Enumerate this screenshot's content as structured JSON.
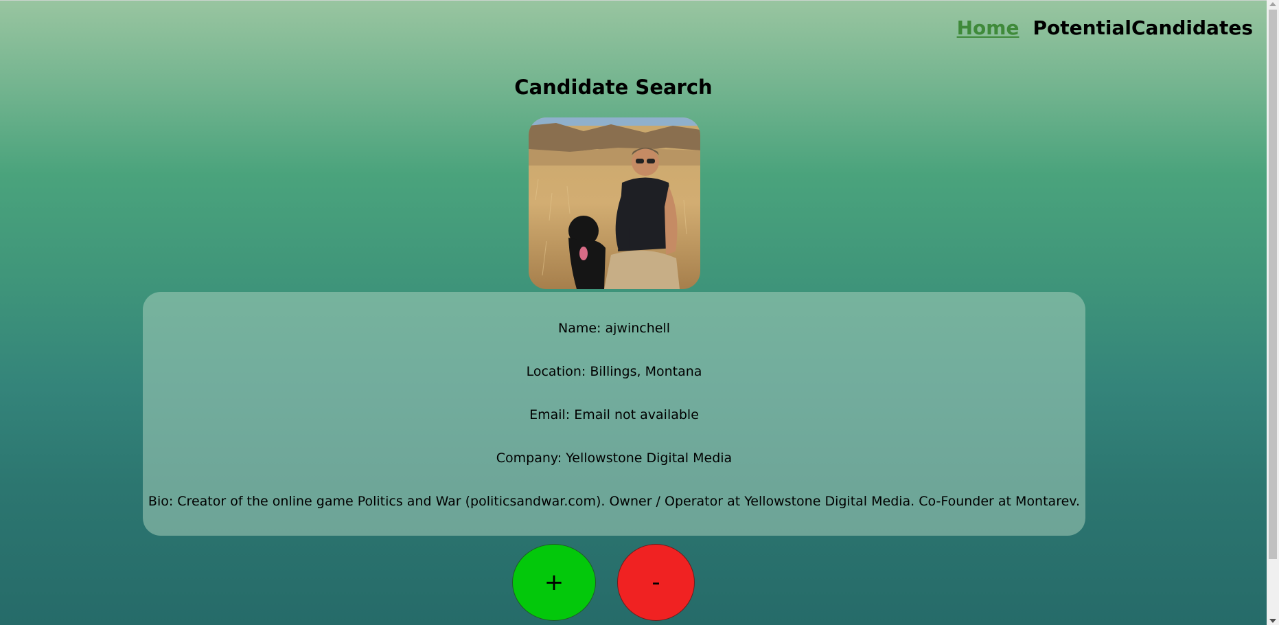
{
  "nav": {
    "home_label": "Home",
    "potential_label": "PotentialCandidates"
  },
  "page": {
    "title": "Candidate Search"
  },
  "candidate": {
    "name": "Name: ajwinchell",
    "location": "Location: Billings, Montana",
    "email": "Email: Email not available",
    "company": "Company: Yellowstone Digital Media",
    "bio": "Bio: Creator of the online game Politics and War (politicsandwar.com). Owner / Operator at Yellowstone Digital Media. Co-Founder at Montarev."
  },
  "actions": {
    "add_label": "+",
    "reject_label": "-"
  },
  "colors": {
    "add": "#03c80b",
    "reject": "#f02222",
    "home_link": "#3f8a3a"
  }
}
